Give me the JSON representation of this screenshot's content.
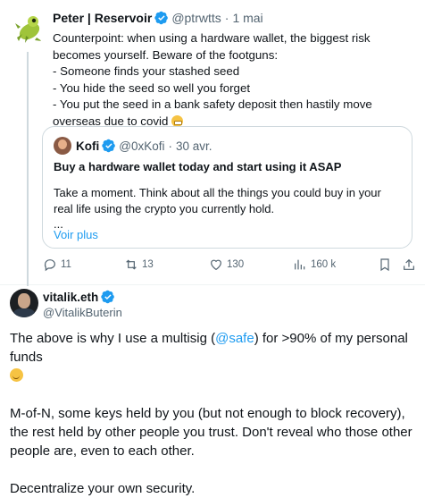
{
  "quoted_reply": {
    "author_name": "Peter | Reservoir",
    "handle": "@ptrwtts",
    "separator": "·",
    "date": "1 mai",
    "text": "Counterpoint: when using a hardware wallet, the biggest risk becomes yourself. Beware of the footguns:\n- Someone finds your stashed seed\n- You hide the seed so well you forget\n- You put the seed in a bank safety deposit then hastily move overseas due to covid",
    "text_emoji": "grimacing-face-emoji",
    "quoted_tweet": {
      "author_name": "Kofi",
      "handle": "@0xKofi",
      "separator": "·",
      "date": "30 avr.",
      "title": "Buy a hardware wallet today and start using it ASAP",
      "body": "Take a moment. Think about all the things you could buy in your real life using the crypto you currently hold.",
      "ellipsis": "...",
      "see_more": "Voir plus"
    },
    "actions": {
      "replies": "11",
      "retweets": "13",
      "likes": "130",
      "views": "160 k"
    }
  },
  "main_tweet": {
    "author_name": "vitalik.eth",
    "handle": "@VitalikButerin",
    "paragraph1_before": "The above is why I use a multisig (",
    "mention": "@safe",
    "paragraph1_after": ") for >90% of my personal funds",
    "paragraph1_emoji": "slightly-smiling-face-emoji",
    "paragraph2": "M-of-N, some keys held by you (but not enough to block recovery), the rest held by other people you trust. Don't reveal who those other people are, even to each other.",
    "paragraph3": "Decentralize your own security."
  },
  "colors": {
    "verified_blue": "#1d9bf0",
    "link_blue": "#1d9bf0",
    "secondary_text": "#536471",
    "border": "#cfd9de"
  }
}
